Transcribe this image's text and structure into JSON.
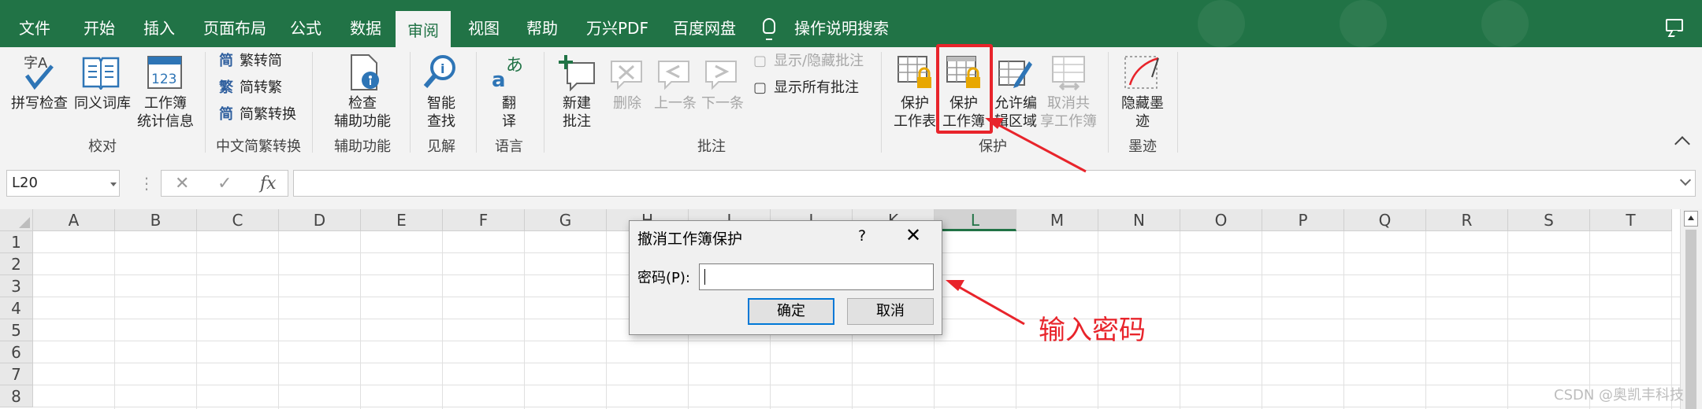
{
  "menu": {
    "tabs": [
      "文件",
      "开始",
      "插入",
      "页面布局",
      "公式",
      "数据",
      "审阅",
      "视图",
      "帮助",
      "万兴PDF",
      "百度网盘"
    ],
    "active_tab": "审阅",
    "search_label": "操作说明搜索"
  },
  "ribbon": {
    "proofing": {
      "spell_check": "拼写检查",
      "thesaurus": "同义词库",
      "workbook_stats": [
        "工作簿",
        "统计信息"
      ],
      "label": "校对"
    },
    "chinese_conversion": {
      "to_simplified": "繁转简",
      "to_traditional": "简转繁",
      "convert": "简繁转换",
      "label": "中文简繁转换"
    },
    "accessibility": {
      "check": [
        "检查",
        "辅助功能"
      ],
      "label": "辅助功能"
    },
    "insights": {
      "smart_lookup": [
        "智能",
        "查找"
      ],
      "label": "见解"
    },
    "language": {
      "translate": [
        "翻",
        "译"
      ],
      "label": "语言"
    },
    "comments": {
      "new_comment": [
        "新建",
        "批注"
      ],
      "delete": "删除",
      "previous": "上一条",
      "next": "下一条",
      "show_hide": "显示/隐藏批注",
      "show_all": "显示所有批注",
      "label": "批注"
    },
    "protect": {
      "protect_sheet": [
        "保护",
        "工作表"
      ],
      "protect_workbook": [
        "保护",
        "工作簿"
      ],
      "allow_edit": [
        "允许编",
        "辑区域"
      ],
      "unshare": [
        "取消共",
        "享工作簿"
      ],
      "label": "保护"
    },
    "ink": {
      "hide_ink": [
        "隐藏墨",
        "迹"
      ],
      "label": "墨迹"
    }
  },
  "formula_bar": {
    "name_box": "L20",
    "fx": "fx",
    "cancel_glyph": "✕",
    "enter_glyph": "✓",
    "formula": ""
  },
  "grid": {
    "columns": [
      "A",
      "B",
      "C",
      "D",
      "E",
      "F",
      "G",
      "H",
      "I",
      "J",
      "K",
      "L",
      "M",
      "N",
      "O",
      "P",
      "Q",
      "R",
      "S",
      "T"
    ],
    "rows": [
      "1",
      "2",
      "3",
      "4",
      "5",
      "6",
      "7",
      "8"
    ],
    "selected_column": "L"
  },
  "dialog": {
    "title": "撤消工作簿保护",
    "help": "?",
    "close": "✕",
    "password_label": "密码(P):",
    "password_value": "",
    "ok": "确定",
    "cancel": "取消"
  },
  "annotation": {
    "text": "输入密码",
    "color": "#e8242b"
  },
  "watermark": "CSDN @奥凯丰科技",
  "colors": {
    "excel_green": "#217346",
    "ribbon_bg": "#f3f3f3",
    "annotation_red": "#e8242b",
    "dialog_accent": "#0078d7"
  }
}
